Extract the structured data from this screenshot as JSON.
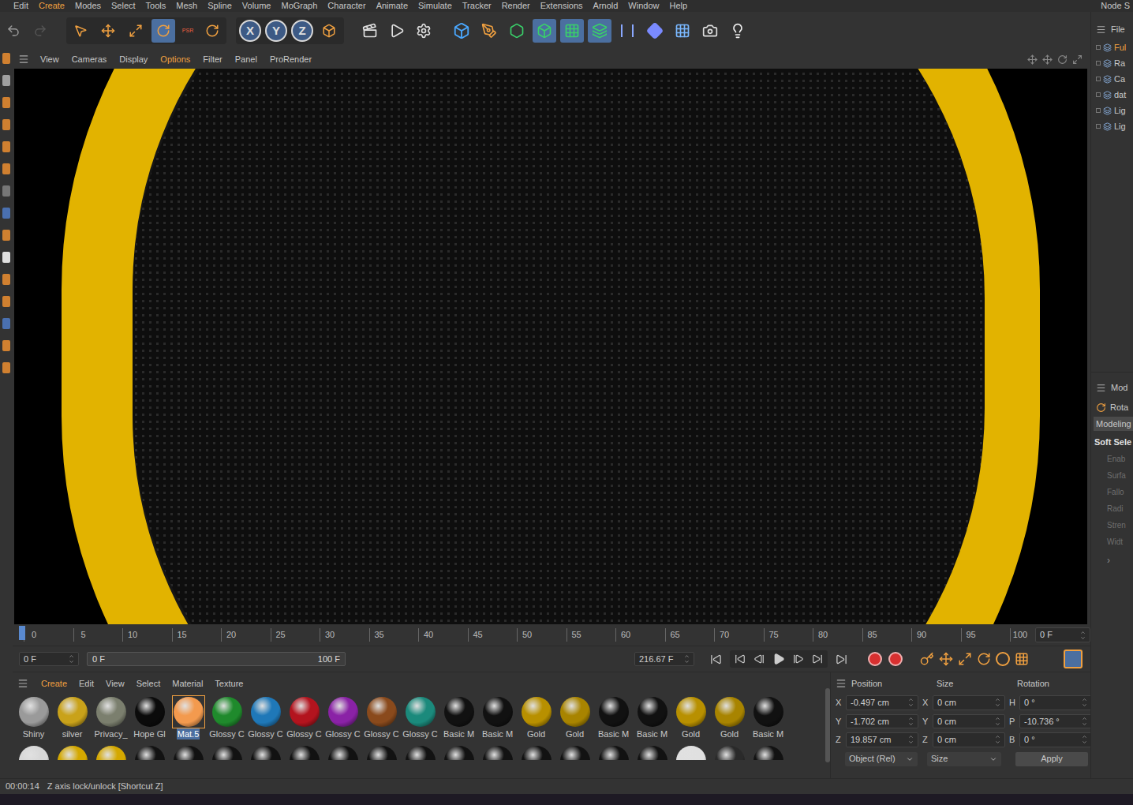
{
  "menu_bar": {
    "items": [
      {
        "label": "Edit",
        "highlighted": false
      },
      {
        "label": "Create",
        "highlighted": true
      },
      {
        "label": "Modes",
        "highlighted": false
      },
      {
        "label": "Select",
        "highlighted": false
      },
      {
        "label": "Tools",
        "highlighted": false
      },
      {
        "label": "Mesh",
        "highlighted": false
      },
      {
        "label": "Spline",
        "highlighted": false
      },
      {
        "label": "Volume",
        "highlighted": false
      },
      {
        "label": "MoGraph",
        "highlighted": false
      },
      {
        "label": "Character",
        "highlighted": false
      },
      {
        "label": "Animate",
        "highlighted": false
      },
      {
        "label": "Simulate",
        "highlighted": false
      },
      {
        "label": "Tracker",
        "highlighted": false
      },
      {
        "label": "Render",
        "highlighted": false
      },
      {
        "label": "Extensions",
        "highlighted": false
      },
      {
        "label": "Arnold",
        "highlighted": false
      },
      {
        "label": "Window",
        "highlighted": false
      },
      {
        "label": "Help",
        "highlighted": false
      }
    ],
    "right": "Node S"
  },
  "toolbar": {
    "psr_label": "PSR",
    "axis_buttons": [
      {
        "label": "X",
        "on": true
      },
      {
        "label": "Y",
        "on": true
      },
      {
        "label": "Z",
        "on": true
      }
    ]
  },
  "viewport_menu": [
    {
      "label": "View",
      "highlighted": false
    },
    {
      "label": "Cameras",
      "highlighted": false
    },
    {
      "label": "Display",
      "highlighted": false
    },
    {
      "label": "Options",
      "highlighted": true
    },
    {
      "label": "Filter",
      "highlighted": false
    },
    {
      "label": "Panel",
      "highlighted": false
    },
    {
      "label": "ProRender",
      "highlighted": false
    }
  ],
  "timeline": {
    "ticks": [
      "0",
      "5",
      "10",
      "15",
      "20",
      "25",
      "30",
      "35",
      "40",
      "45",
      "50",
      "55",
      "60",
      "65",
      "70",
      "75",
      "80",
      "85",
      "90",
      "95",
      "100"
    ],
    "current_frame_field": "0 F"
  },
  "playback": {
    "start_field": "0 F",
    "range_start": "0 F",
    "range_end": "100 F",
    "fps_field": "216.67 F"
  },
  "materials": {
    "menu": [
      {
        "label": "Create",
        "highlighted": true
      },
      {
        "label": "Edit",
        "highlighted": false
      },
      {
        "label": "View",
        "highlighted": false
      },
      {
        "label": "Select",
        "highlighted": false
      },
      {
        "label": "Material",
        "highlighted": false
      },
      {
        "label": "Texture",
        "highlighted": false
      }
    ],
    "items": [
      {
        "name": "Shiny",
        "color": "#9a9a9a",
        "selected": false
      },
      {
        "name": "silver",
        "color": "#c9a21a",
        "selected": false
      },
      {
        "name": "Privacy_",
        "color": "#7b7f6e",
        "selected": false
      },
      {
        "name": "Hope Gl",
        "color": "#0b0b0b",
        "selected": false
      },
      {
        "name": "Mat.5",
        "color": "#f39a4e",
        "selected": true
      },
      {
        "name": "Glossy C",
        "color": "#1f8a2c",
        "selected": false
      },
      {
        "name": "Glossy C",
        "color": "#1f78b8",
        "selected": false
      },
      {
        "name": "Glossy C",
        "color": "#b3141e",
        "selected": false
      },
      {
        "name": "Glossy C",
        "color": "#8a22a6",
        "selected": false
      },
      {
        "name": "Glossy C",
        "color": "#8a4a1c",
        "selected": false
      },
      {
        "name": "Glossy C",
        "color": "#1b8a7c",
        "selected": false
      },
      {
        "name": "Basic M",
        "color": "#111111",
        "selected": false
      },
      {
        "name": "Basic M",
        "color": "#111111",
        "selected": false
      },
      {
        "name": "Gold",
        "color": "#b89000",
        "selected": false
      },
      {
        "name": "Gold",
        "color": "#a88400",
        "selected": false
      },
      {
        "name": "Basic M",
        "color": "#111111",
        "selected": false
      },
      {
        "name": "Basic M",
        "color": "#111111",
        "selected": false
      },
      {
        "name": "Gold",
        "color": "#b89000",
        "selected": false
      },
      {
        "name": "Gold",
        "color": "#a88400",
        "selected": false
      },
      {
        "name": "Basic M",
        "color": "#111111",
        "selected": false
      }
    ],
    "second_row": [
      {
        "color": "#d8d8d8"
      },
      {
        "color": "#d4a800"
      },
      {
        "color": "#d4a800"
      },
      {
        "color": "#121212"
      },
      {
        "color": "#121212"
      },
      {
        "color": "#121212"
      },
      {
        "color": "#121212"
      },
      {
        "color": "#121212"
      },
      {
        "color": "#121212"
      },
      {
        "color": "#121212"
      },
      {
        "color": "#121212"
      },
      {
        "color": "#121212"
      },
      {
        "color": "#121212"
      },
      {
        "color": "#121212"
      },
      {
        "color": "#121212"
      },
      {
        "color": "#121212"
      },
      {
        "color": "#121212"
      },
      {
        "color": "#e0e0e0"
      },
      {
        "color": "#2a2a2a"
      },
      {
        "color": "#121212"
      }
    ]
  },
  "coordinates": {
    "headers": [
      "Position",
      "Size",
      "Rotation"
    ],
    "rows": [
      {
        "axis": "X",
        "position": "-0.497 cm",
        "size_axis": "X",
        "size": "0 cm",
        "rot_axis": "H",
        "rotation": "0 °"
      },
      {
        "axis": "Y",
        "position": "-1.702 cm",
        "size_axis": "Y",
        "size": "0 cm",
        "rot_axis": "P",
        "rotation": "-10.736 °"
      },
      {
        "axis": "Z",
        "position": "19.857 cm",
        "size_axis": "Z",
        "size": "0 cm",
        "rot_axis": "B",
        "rotation": "0 °"
      }
    ],
    "mode_dropdown": "Object (Rel)",
    "size_dropdown": "Size",
    "apply": "Apply"
  },
  "objects_panel": {
    "menu": "File",
    "items": [
      {
        "label": "Ful",
        "highlighted": true
      },
      {
        "label": "Ra",
        "highlighted": false
      },
      {
        "label": "Ca",
        "highlighted": false
      },
      {
        "label": "dat",
        "highlighted": false
      },
      {
        "label": "Lig",
        "highlighted": false
      },
      {
        "label": "Lig",
        "highlighted": false
      }
    ]
  },
  "attributes_panel": {
    "menu": "Mod",
    "mode": "Rota",
    "tab": "Modeling",
    "section": "Soft Sele",
    "fields": [
      "Enab",
      "Surfa",
      "Fallo",
      "Radi",
      "Stren",
      "Widt"
    ],
    "more": "›"
  },
  "status_bar": {
    "time": "00:00:14",
    "message": "Z axis lock/unlock [Shortcut Z]"
  }
}
